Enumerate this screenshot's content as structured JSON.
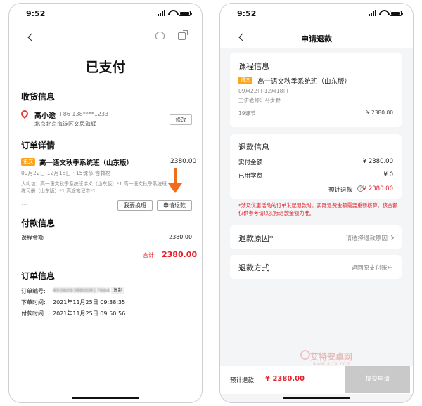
{
  "status": {
    "time": "9:52"
  },
  "left": {
    "title": "已支付",
    "shipping": {
      "section_title": "收货信息",
      "name": "高小途",
      "phone": "+86 138****1233",
      "address": "北京北京海淀区文思海辉",
      "edit_label": "修改"
    },
    "order_detail": {
      "section_title": "订单详情",
      "tag": "语文",
      "course_name": "高一语文秋季系统班（山东版）",
      "price": "2380.00",
      "meta": "09月22日-12月18日 · 15课节  含教材",
      "gift_line1": "大礼包：高一语文秋季系统班讲义（山东版）*1  高一语文秋季系统班",
      "gift_line2": "练习册（山东版）*1  高途笔记本*1",
      "more": "···",
      "switch_label": "我要换班",
      "refund_label": "申请退款"
    },
    "payment": {
      "section_title": "付款信息",
      "amount_label": "课程金额",
      "amount_value": "2380.00",
      "total_label": "合计:",
      "total_value": "2380.00"
    },
    "order_info": {
      "section_title": "订单信息",
      "number_label": "订单编号:",
      "number_value": "49360938800817664",
      "copy_label": "复制",
      "placed_label": "下单时间:",
      "placed_value": "2021年11月25日 09:38:35",
      "paid_label": "付款时间:",
      "paid_value": "2021年11月25日 09:50:56"
    }
  },
  "right": {
    "title": "申请退款",
    "course": {
      "section_title": "课程信息",
      "tag": "语文",
      "course_name": "高一语文秋季系统班（山东版）",
      "dates": "09月22日-12月18日",
      "teacher": "主讲老师：马步野",
      "lessons": "19课节",
      "price": "¥ 2380.00"
    },
    "refund_info": {
      "section_title": "退款信息",
      "paid_label": "实付金额",
      "paid_value": "¥ 2380.00",
      "used_label": "已用学费",
      "used_value": "¥ 0",
      "estimate_label": "预计退款",
      "estimate_value": "¥ 2380.00"
    },
    "notice": "*涉及优惠活动的订单发起退款时，实际退费金额需要重新核算，该金额仅供参考请以实际退款金额为准。",
    "reason": {
      "label": "退款原因*",
      "placeholder": "请选择退款原因"
    },
    "method": {
      "label": "退款方式",
      "value": "返回原支付账户"
    },
    "footer": {
      "estimate_label": "预计退款:",
      "estimate_value": "¥ 2380.00",
      "submit_label": "提交申请"
    },
    "watermark": {
      "text": "艾特安卓网",
      "sub": "www.aite.com"
    }
  },
  "colors": {
    "accent_red": "#e5202a",
    "tag_orange": "#ffa31a",
    "arrow_orange": "#f06c1d"
  }
}
